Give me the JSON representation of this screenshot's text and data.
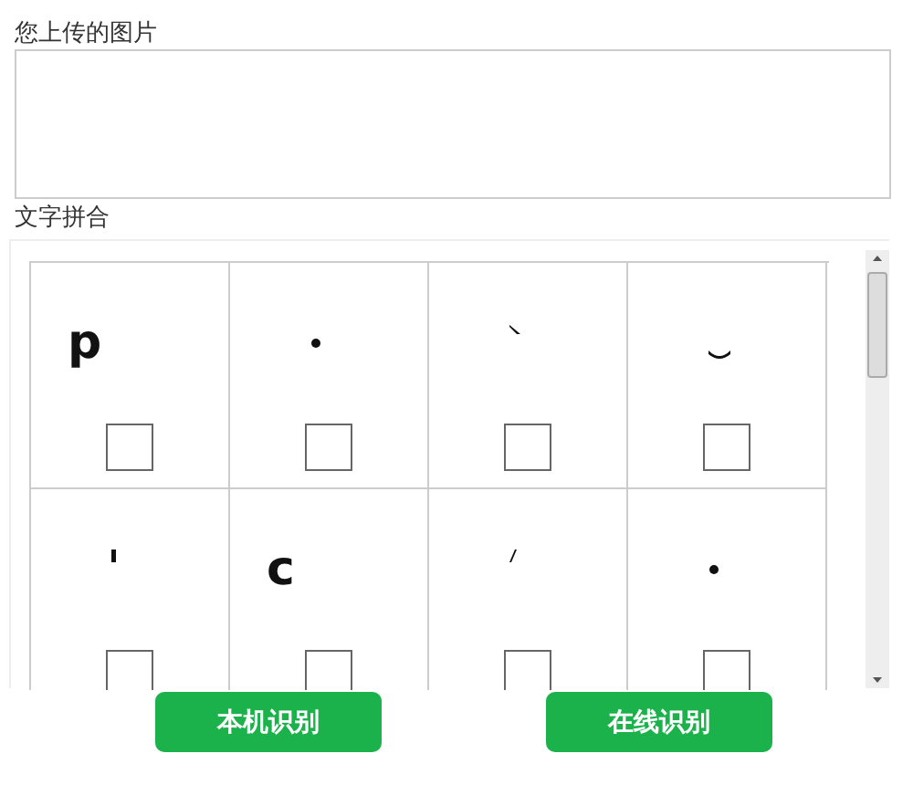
{
  "upload": {
    "label": "您上传的图片"
  },
  "merge": {
    "label": "文字拼合",
    "cells": [
      {
        "kind": "letter",
        "text": "p",
        "checked": false
      },
      {
        "kind": "dot",
        "checked": false
      },
      {
        "kind": "grave",
        "checked": false
      },
      {
        "kind": "arc",
        "checked": false
      },
      {
        "kind": "tick",
        "checked": false
      },
      {
        "kind": "letter",
        "text": "c",
        "checked": false
      },
      {
        "kind": "acute",
        "checked": false
      },
      {
        "kind": "dot",
        "checked": false
      }
    ]
  },
  "buttons": [
    "本机识别",
    "在线识别"
  ]
}
